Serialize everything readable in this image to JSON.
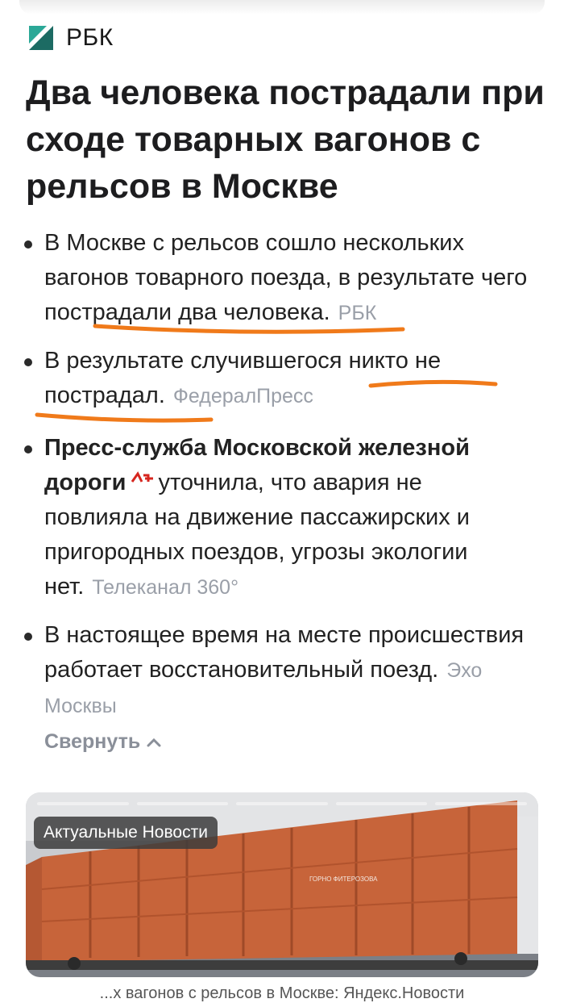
{
  "source": {
    "name": "РБК"
  },
  "headline": "Два человека пострадали при сходе товарных вагонов с рельсов в Москве",
  "bullets": [
    {
      "text": "В Москве с рельсов сошло нескольких вагонов товарного поезда, в результате чего пострадали два человека.",
      "source": "РБК"
    },
    {
      "text": "В результате случившегося никто не пострадал.",
      "source": "ФедералПресс"
    },
    {
      "bold": "Пресс-служба Московской железной дороги",
      "text": "уточнила, что авария не повлияла на движение пассажирских и пригородных поездов, угрозы экологии нет.",
      "source": "Телеканал 360°"
    },
    {
      "text": "В настоящее время на месте происшествия работает восстановительный поезд.",
      "source": "Эхо Москвы"
    }
  ],
  "collapse_label": "Свернуть",
  "card": {
    "badge": "Актуальные Новости",
    "wagon_marking": "ГОРНО ФИТЕРОЗОВА",
    "caption": "...х вагонов с рельсов в Москве: Яндекс.Новости",
    "progress_segments": 5
  },
  "colors": {
    "highlight": "#f07a1a",
    "source_grey": "#9a9fa8",
    "wagon": "#c7643a"
  }
}
